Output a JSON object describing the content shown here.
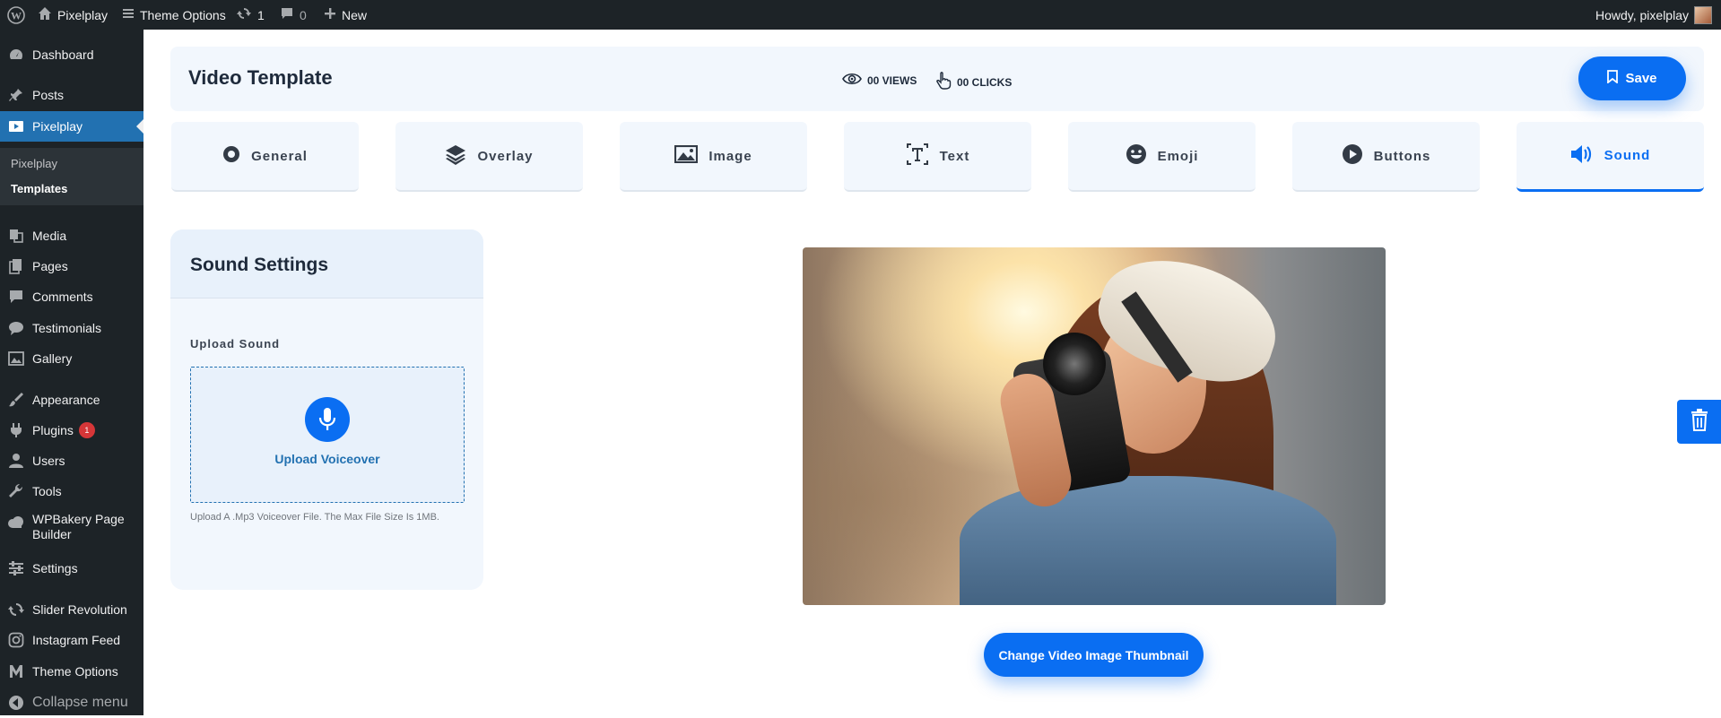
{
  "admin_bar": {
    "site_name": "Pixelplay",
    "theme_options": "Theme Options",
    "updates_count": "1",
    "comments_count": "0",
    "new_label": "New",
    "howdy": "Howdy, pixelplay"
  },
  "sidebar": {
    "items": [
      {
        "label": "Dashboard",
        "icon": "dashboard-icon"
      },
      {
        "label": "Posts",
        "icon": "pin-icon"
      },
      {
        "label": "Pixelplay",
        "icon": "video-icon",
        "active": true
      },
      {
        "label": "Media",
        "icon": "media-icon"
      },
      {
        "label": "Pages",
        "icon": "pages-icon"
      },
      {
        "label": "Comments",
        "icon": "comment-icon"
      },
      {
        "label": "Testimonials",
        "icon": "testimonial-icon"
      },
      {
        "label": "Gallery",
        "icon": "gallery-icon"
      },
      {
        "label": "Appearance",
        "icon": "brush-icon"
      },
      {
        "label": "Plugins",
        "icon": "plugin-icon",
        "badge": "1"
      },
      {
        "label": "Users",
        "icon": "user-icon"
      },
      {
        "label": "Tools",
        "icon": "wrench-icon"
      },
      {
        "label": "WPBakery Page Builder",
        "icon": "cloud-icon"
      },
      {
        "label": "Settings",
        "icon": "settings-icon"
      },
      {
        "label": "Slider Revolution",
        "icon": "refresh-icon"
      },
      {
        "label": "Instagram Feed",
        "icon": "instagram-icon"
      },
      {
        "label": "Theme Options",
        "icon": "m-icon"
      },
      {
        "label": "Collapse menu",
        "icon": "collapse-icon"
      }
    ],
    "submenu": [
      {
        "label": "Pixelplay"
      },
      {
        "label": "Templates",
        "current": true
      }
    ]
  },
  "header": {
    "title": "Video Template",
    "views": "00 VIEWS",
    "clicks": "00 CLICKS",
    "save_label": "Save"
  },
  "tabs": [
    {
      "label": "General",
      "icon": "gear-icon"
    },
    {
      "label": "Overlay",
      "icon": "layers-icon"
    },
    {
      "label": "Image",
      "icon": "image-icon"
    },
    {
      "label": "Text",
      "icon": "text-icon"
    },
    {
      "label": "Emoji",
      "icon": "smiley-icon"
    },
    {
      "label": "Buttons",
      "icon": "play-icon"
    },
    {
      "label": "Sound",
      "icon": "speaker-icon",
      "active": true
    }
  ],
  "sound_panel": {
    "title": "Sound Settings",
    "upload_label": "Upload Sound",
    "upload_button": "Upload Voiceover",
    "hint": "Upload A .Mp3 Voiceover File. The Max File Size Is 1MB."
  },
  "preview": {
    "change_button": "Change Video Image Thumbnail"
  },
  "colors": {
    "accent": "#0a6ef2",
    "wp_dark": "#1d2327",
    "wp_active": "#2271b1",
    "panel_bg": "#f2f7fd"
  }
}
